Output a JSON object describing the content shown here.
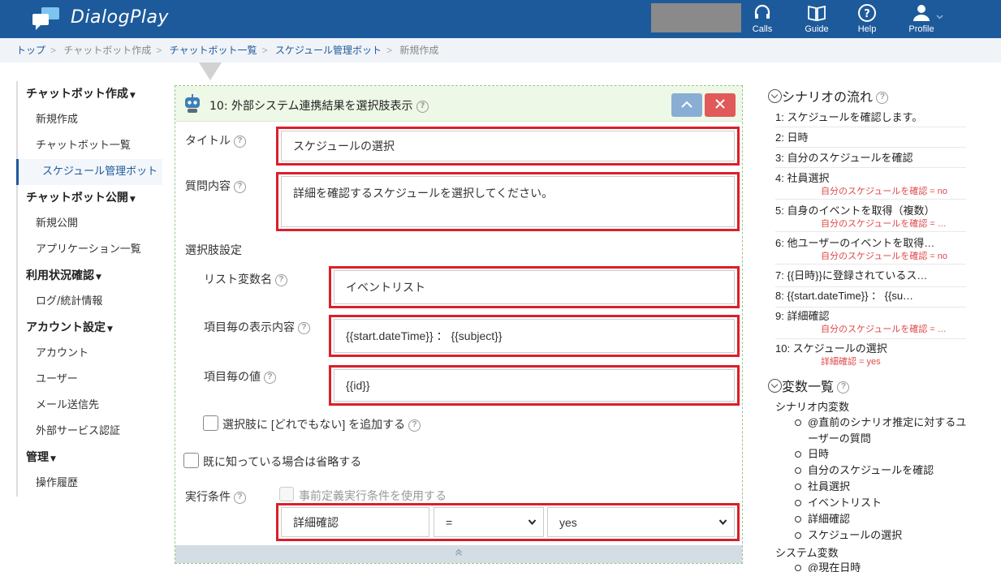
{
  "app": {
    "title": "DialogPlay"
  },
  "topnav": {
    "calls": "Calls",
    "guide": "Guide",
    "help": "Help",
    "profile": "Profile"
  },
  "breadcrumb": [
    "トップ",
    "チャットボット作成",
    "チャットボット一覧",
    "スケジュール管理ボット",
    "新規作成"
  ],
  "sidebar": {
    "groups": [
      {
        "label": "チャットボット作成",
        "items": [
          "新規作成",
          "チャットボット一覧",
          "スケジュール管理ボット"
        ]
      },
      {
        "label": "チャットボット公開",
        "items": [
          "新規公開",
          "アプリケーション一覧"
        ]
      },
      {
        "label": "利用状況確認",
        "items": [
          "ログ/統計情報"
        ]
      },
      {
        "label": "アカウント設定",
        "items": [
          "アカウント",
          "ユーザー",
          "メール送信先",
          "外部サービス認証"
        ]
      },
      {
        "label": "管理",
        "items": [
          "操作履歴"
        ]
      }
    ]
  },
  "panel": {
    "title": "10: 外部システム連携結果を選択肢表示",
    "title_label": "タイトル",
    "title_value": "スケジュールの選択",
    "question_label": "質問内容",
    "question_value": "詳細を確認するスケジュールを選択してください。",
    "choices_section": "選択肢設定",
    "list_var_label": "リスト変数名",
    "list_var_value": "イベントリスト",
    "display_label": "項目毎の表示内容",
    "display_value": "{{start.dateTime}} ： {{subject}}",
    "value_label": "項目毎の値",
    "value_value": "{{id}}",
    "none_option_label": "選択肢に [どれでもない] を追加する",
    "skip_known_label": "既に知っている場合は省略する",
    "exec_cond_label": "実行条件",
    "predefined_label": "事前定義実行条件を使用する",
    "cond_variable": "詳細確認",
    "cond_operator": "=",
    "cond_value": "yes"
  },
  "flow": {
    "heading": "シナリオの流れ",
    "steps": [
      {
        "text": "1: スケジュールを確認します。",
        "cond": ""
      },
      {
        "text": "2: 日時",
        "cond": ""
      },
      {
        "text": "3: 自分のスケジュールを確認",
        "cond": ""
      },
      {
        "text": "4: 社員選択",
        "cond": "自分のスケジュールを確認 = no"
      },
      {
        "text": "5: 自身のイベントを取得（複数）",
        "cond": "自分のスケジュールを確認 = …"
      },
      {
        "text": "6: 他ユーザーのイベントを取得…",
        "cond": "自分のスケジュールを確認 = no"
      },
      {
        "text": "7: {{日時}}に登録されているス…",
        "cond": ""
      },
      {
        "text": "8: {{start.dateTime}} ： {{su…",
        "cond": ""
      },
      {
        "text": "9: 詳細確認",
        "cond": "自分のスケジュールを確認 = …"
      },
      {
        "text": "10: スケジュールの選択",
        "cond": "詳細確認 = yes"
      }
    ]
  },
  "variables": {
    "heading": "変数一覧",
    "scenario_heading": "シナリオ内変数",
    "scenario_items": [
      "@直前のシナリオ推定に対するユーザーの質問",
      "日時",
      "自分のスケジュールを確認",
      "社員選択",
      "イベントリスト",
      "詳細確認",
      "スケジュールの選択"
    ],
    "system_heading": "システム変数",
    "system_items": [
      "@現在日時"
    ]
  },
  "colors": {
    "header": "#1d5a9b",
    "highlight": "#d9202a",
    "panel_header": "#eef8e6"
  }
}
